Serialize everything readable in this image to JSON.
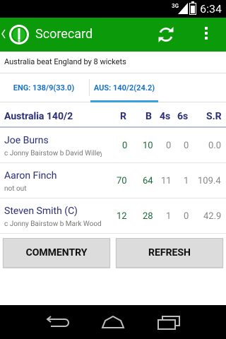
{
  "status_bar": {
    "network": "3G",
    "time": "6:34"
  },
  "action_bar": {
    "title": "Scorecard",
    "accent_color": "#0a9a0a"
  },
  "result_text": "Australia beat England by 8 wickets",
  "tabs": [
    {
      "label": "ENG: 138/9(33.0)",
      "selected": false
    },
    {
      "label": "AUS: 140/2(24.2)",
      "selected": true
    }
  ],
  "table": {
    "team": "Australia 140/2",
    "columns": [
      "R",
      "B",
      "4s",
      "6s",
      "S.R"
    ],
    "rows": [
      {
        "name": "Joe Burns",
        "dismissal": "c Jonny Bairstow b David Willey",
        "r": "0",
        "b": "10",
        "fours": "0",
        "sixes": "0",
        "sr": "0.0"
      },
      {
        "name": "Aaron Finch",
        "dismissal": "not out",
        "r": "70",
        "b": "64",
        "fours": "11",
        "sixes": "1",
        "sr": "109.4"
      },
      {
        "name": "Steven Smith (C)",
        "dismissal": "c Jonny Bairstow b Mark Wood",
        "r": "12",
        "b": "28",
        "fours": "1",
        "sixes": "0",
        "sr": "42.9"
      }
    ]
  },
  "buttons": {
    "commentary": "COMMENTRY",
    "refresh": "REFRESH"
  },
  "icons": {
    "logo": "app-logo-icon",
    "refresh": "refresh-icon",
    "overflow": "overflow-menu-icon",
    "back": "back-icon",
    "home": "home-icon",
    "recents": "recents-icon"
  }
}
